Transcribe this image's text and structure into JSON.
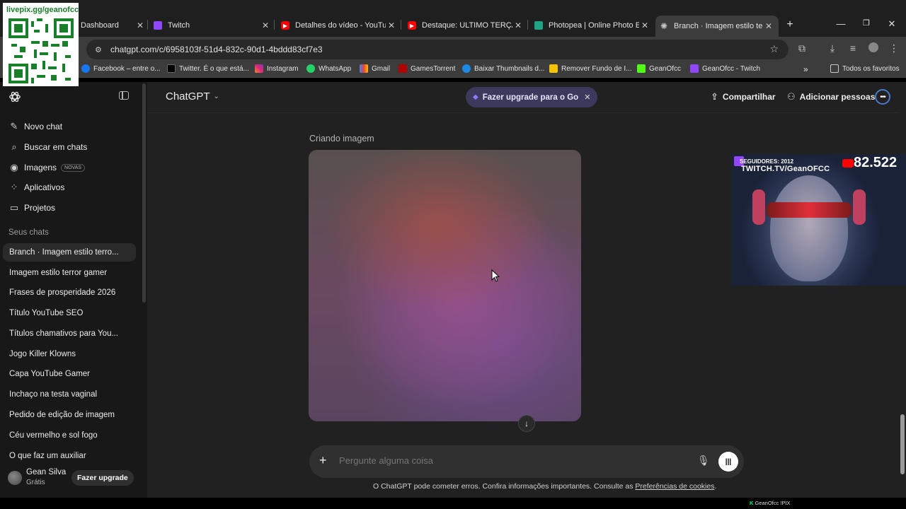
{
  "browser": {
    "tabs": [
      {
        "label": "Dashboard",
        "color": "#ff4a4a"
      },
      {
        "label": "Twitch",
        "color": "#9147ff"
      },
      {
        "label": "Detalhes do vídeo - YouTube",
        "color": "#ff0000"
      },
      {
        "label": "Destaque: ULTIMO TERÇA DO",
        "color": "#ff0000"
      },
      {
        "label": "Photopea | Online Photo Edi",
        "color": "#1fa386"
      },
      {
        "label": "Branch · Imagem estilo terro",
        "color": "#c7c7c7"
      }
    ],
    "url": "chatgpt.com/c/6958103f-51d4-832c-90d1-4bddd83cf7e3",
    "bookmarks": [
      {
        "label": "Facebook – entre o...",
        "color": "#1877f2"
      },
      {
        "label": "Twitter. É o que está...",
        "color": "#000000"
      },
      {
        "label": "Instagram",
        "color": "#e1306c"
      },
      {
        "label": "WhatsApp",
        "color": "#25d366"
      },
      {
        "label": "Gmail",
        "color": "#ea4335"
      },
      {
        "label": "GamesTorrent",
        "color": "#b10000"
      },
      {
        "label": "Baixar Thumbnails d...",
        "color": "#1e88e5"
      },
      {
        "label": "Remover Fundo de I...",
        "color": "#f5c400"
      },
      {
        "label": "GeanOfcc",
        "color": "#53fc18"
      },
      {
        "label": "GeanOfcc - Twitch",
        "color": "#9147ff"
      }
    ],
    "all_bookmarks": "Todos os favoritos"
  },
  "overlay": {
    "qr_text": "livepix.gg/geanofcc",
    "followers": "SEGUIDORES: 2012",
    "twitch": "TWITCH.TV/GeanOFCC",
    "yt_count": "82.522"
  },
  "sidebar": {
    "nav": [
      {
        "label": "Novo chat",
        "icon": "edit-icon"
      },
      {
        "label": "Buscar em chats",
        "icon": "search-icon"
      },
      {
        "label": "Imagens",
        "icon": "image-icon"
      },
      {
        "label": "Aplicativos",
        "icon": "apps-icon"
      },
      {
        "label": "Projetos",
        "icon": "folder-icon"
      }
    ],
    "new_badge": "NOVAS",
    "section_title": "Seus chats",
    "chats": [
      "Branch · Imagem estilo terro...",
      "Imagem estilo terror gamer",
      "Frases de prosperidade 2026",
      "Título YouTube SEO",
      "Títulos chamativos para You...",
      "Jogo Killer Klowns",
      "Capa YouTube Gamer",
      "Inchaço na testa vaginal",
      "Pedido de edição de imagem",
      "Céu vermelho e sol fogo",
      "O que faz um auxiliar"
    ],
    "user": {
      "name": "Gean Silva",
      "plan": "Grátis",
      "upgrade": "Fazer upgrade"
    }
  },
  "header": {
    "model": "ChatGPT",
    "upgrade_pill": "Fazer upgrade para o Go",
    "share": "Compartilhar",
    "add_people": "Adicionar pessoas"
  },
  "main": {
    "status": "Criando imagem",
    "composer_placeholder": "Pergunte alguma coisa",
    "disclaimer_text": "O ChatGPT pode cometer erros. Confira informações importantes. Consulte as ",
    "disclaimer_link": "Preferências de cookies",
    "disclaimer_end": "."
  },
  "taskbar": {
    "ticker": "GeanOfcc !PIX"
  }
}
